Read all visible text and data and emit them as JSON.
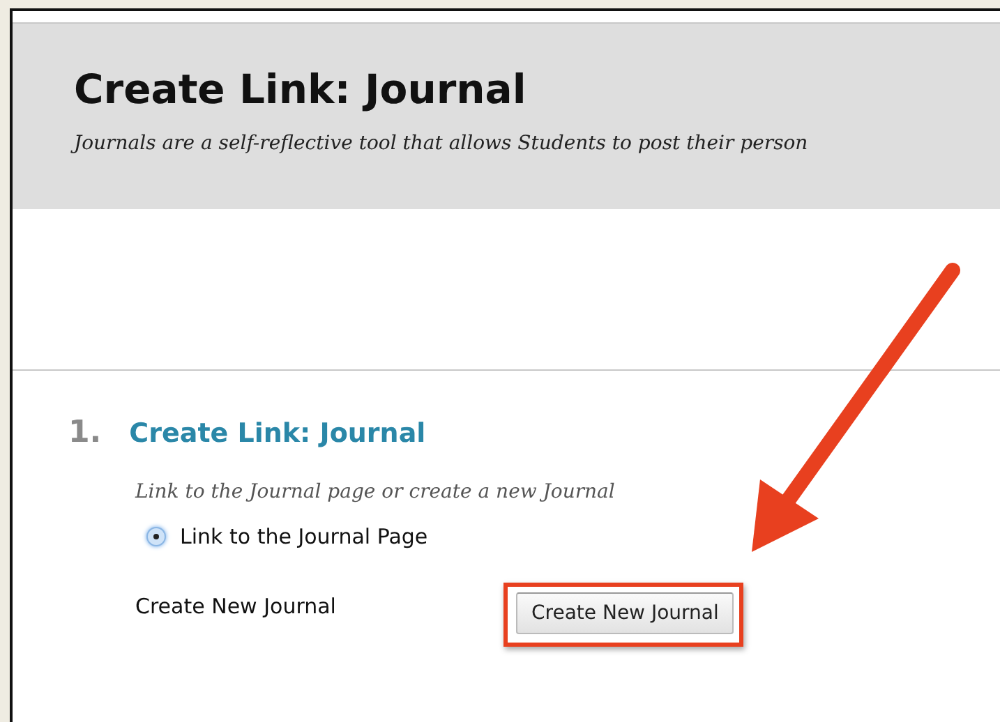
{
  "header": {
    "title": "Create Link: Journal",
    "description": "Journals are a self-reflective tool that allows Students to post their person"
  },
  "step": {
    "number": "1.",
    "title": "Create Link: Journal",
    "instructions": "Link to the Journal page or create a new Journal",
    "options": [
      {
        "label": "Link to the Journal Page",
        "selected": true
      }
    ],
    "create": {
      "label": "Create New Journal",
      "button": "Create New Journal",
      "highlighted": true
    }
  },
  "annotation": {
    "kind": "arrow"
  }
}
